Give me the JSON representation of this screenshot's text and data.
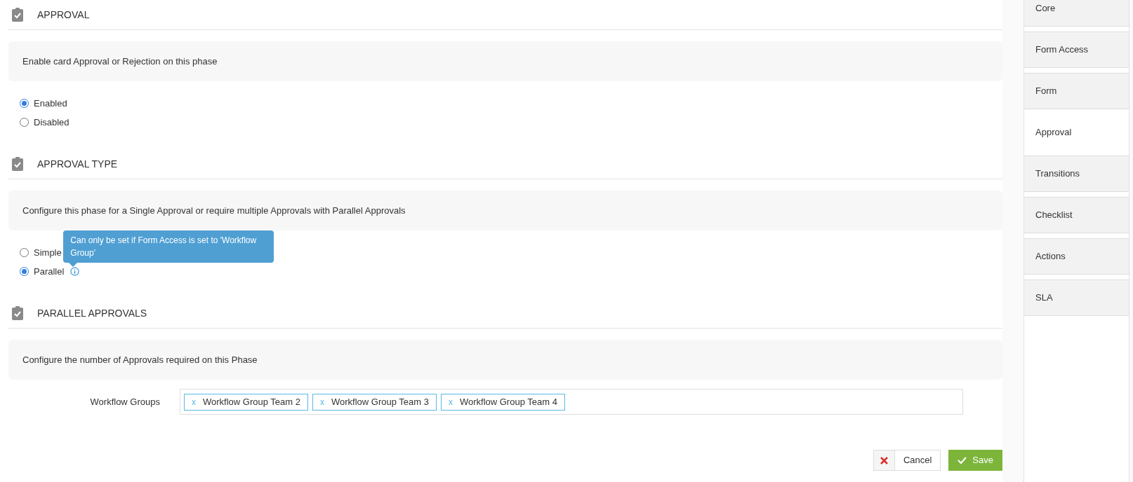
{
  "sections": [
    {
      "title": "APPROVAL",
      "description": "Enable card Approval or Rejection on this phase",
      "options": [
        {
          "label": "Enabled",
          "selected": true,
          "info": false
        },
        {
          "label": "Disabled",
          "selected": false,
          "info": false
        }
      ]
    },
    {
      "title": "APPROVAL TYPE",
      "description": "Configure this phase for a Single Approval or require multiple Approvals with Parallel Approvals",
      "options": [
        {
          "label": "Simple",
          "selected": false,
          "info": false
        },
        {
          "label": "Parallel",
          "selected": true,
          "info": true
        }
      ],
      "tooltip": "Can only be set if Form Access is set to 'Workflow Group'"
    },
    {
      "title": "PARALLEL APPROVALS",
      "description": "Configure the number of Approvals required on this Phase",
      "field": {
        "label": "Workflow Groups",
        "tags": [
          {
            "remove": "x",
            "label": "Workflow Group Team 2"
          },
          {
            "remove": "x",
            "label": "Workflow Group Team 3"
          },
          {
            "remove": "x",
            "label": "Workflow Group Team 4"
          }
        ]
      }
    }
  ],
  "buttons": {
    "cancel": "Cancel",
    "save": "Save"
  },
  "tabs": [
    {
      "label": "Core",
      "selected": false
    },
    {
      "label": "Form Access",
      "selected": false
    },
    {
      "label": "Form",
      "selected": false
    },
    {
      "label": "Approval",
      "selected": true
    },
    {
      "label": "Transitions",
      "selected": false
    },
    {
      "label": "Checklist",
      "selected": false
    },
    {
      "label": "Actions",
      "selected": false
    },
    {
      "label": "SLA",
      "selected": false
    }
  ]
}
